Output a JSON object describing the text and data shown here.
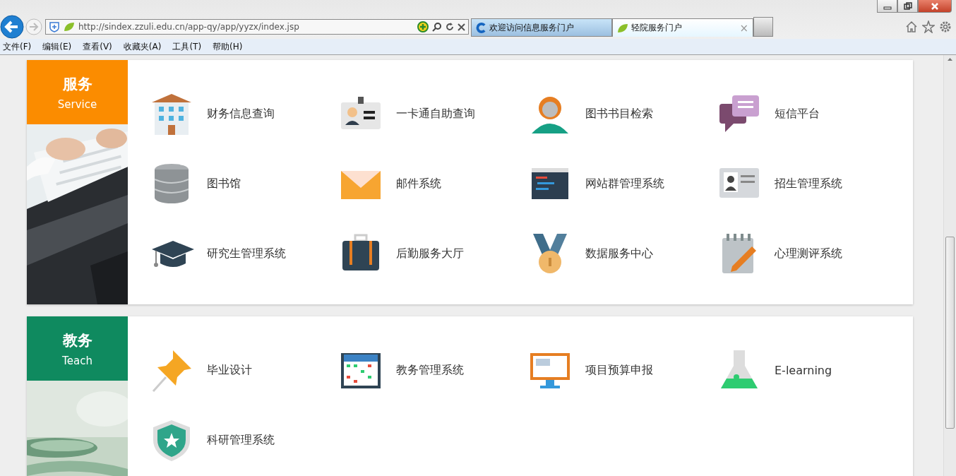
{
  "browser": {
    "address": "http://sindex.zzuli.edu.cn/app-qy/app/yyzx/index.jsp",
    "tabs": [
      {
        "label": "欢迎访问信息服务门户",
        "selected": false,
        "closable": false
      },
      {
        "label": "轻院服务门户",
        "selected": true,
        "closable": true
      }
    ],
    "close_tab": "×",
    "menu": [
      "文件(F)",
      "编辑(E)",
      "查看(V)",
      "收藏夹(A)",
      "工具(T)",
      "帮助(H)"
    ]
  },
  "sections": [
    {
      "title": "服务",
      "subtitle": "Service",
      "color": "#fb8c00",
      "items": [
        {
          "label": "财务信息查询"
        },
        {
          "label": "一卡通自助查询"
        },
        {
          "label": "图书书目检索"
        },
        {
          "label": "短信平台"
        },
        {
          "label": "图书馆"
        },
        {
          "label": "邮件系统"
        },
        {
          "label": "网站群管理系统"
        },
        {
          "label": "招生管理系统"
        },
        {
          "label": "研究生管理系统"
        },
        {
          "label": "后勤服务大厅"
        },
        {
          "label": "数据服务中心"
        },
        {
          "label": "心理测评系统"
        }
      ]
    },
    {
      "title": "教务",
      "subtitle": "Teach",
      "color": "#0f8a5f",
      "items": [
        {
          "label": "毕业设计"
        },
        {
          "label": "教务管理系统"
        },
        {
          "label": "项目预算申报"
        },
        {
          "label": "E-learning"
        },
        {
          "label": "科研管理系统"
        }
      ]
    }
  ]
}
